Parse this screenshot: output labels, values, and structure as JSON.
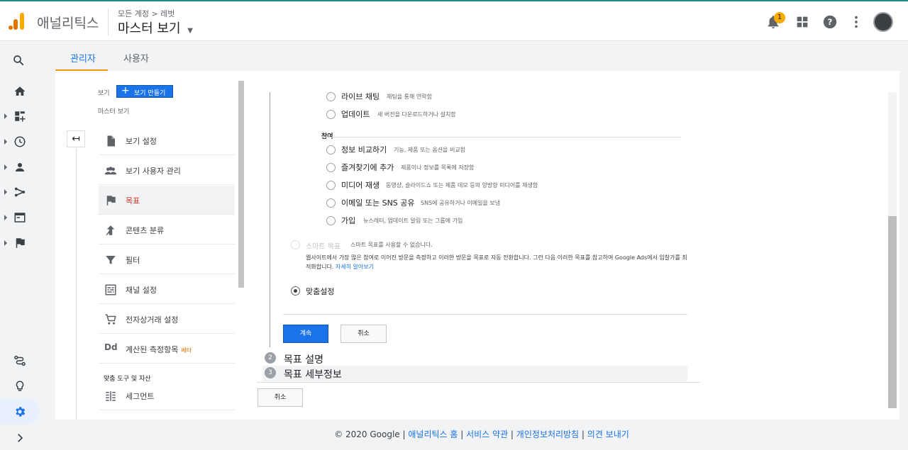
{
  "app": {
    "name": "애널리틱스",
    "breadcrumb": "모든 계정 > 레벗",
    "view_title": "마스터 보기",
    "notification_count": "1"
  },
  "tabs": [
    {
      "label": "관리자",
      "active": true
    },
    {
      "label": "사용자",
      "active": false
    }
  ],
  "left_nav": {
    "view_label": "보기",
    "create_view_button": "보기 만들기",
    "current_view": "마스터 보기",
    "items": [
      {
        "label": "보기 설정",
        "icon": "document-icon"
      },
      {
        "label": "보기 사용자 관리",
        "icon": "people-icon"
      },
      {
        "label": "목표",
        "icon": "flag-icon",
        "active": true
      },
      {
        "label": "콘텐츠 분류",
        "icon": "content-grouping-icon"
      },
      {
        "label": "필터",
        "icon": "filter-icon"
      },
      {
        "label": "채널 설정",
        "icon": "channel-settings-icon"
      },
      {
        "label": "전자상거래 설정",
        "icon": "cart-icon"
      },
      {
        "label": "계산된 측정항목",
        "icon": "dd-icon",
        "beta": "베타"
      }
    ],
    "tools_section": "맞춤 도구 및 자산",
    "tools_items": [
      {
        "label": "세그먼트",
        "icon": "segments-icon"
      }
    ]
  },
  "goal_options": {
    "top_options": [
      {
        "label": "라이브 채팅",
        "desc": "채팅을 통해 연락함"
      },
      {
        "label": "업데이트",
        "desc": "새 버전을 다운로드하거나 설치함"
      }
    ],
    "engagement_header": "참여",
    "engagement_options": [
      {
        "label": "정보 비교하기",
        "desc": "기능, 제품 또는 옵션을 비교함"
      },
      {
        "label": "즐겨찾기에 추가",
        "desc": "제품이나 정보를 목록에 저장함"
      },
      {
        "label": "미디어 재생",
        "desc": "동영상, 슬라이드쇼 또는 제품 데모 등의 양방향 미디어를 재생함"
      },
      {
        "label": "이메일 또는 SNS 공유",
        "desc": "SNS에 공유하거나 이메일을 보냄"
      },
      {
        "label": "가입",
        "desc": "뉴스레터, 업데이트 알림 또는 그룹에 가입"
      }
    ],
    "smart_goal_label": "스마트 목표",
    "smart_goal_desc": "스마트 목표를 사용할 수 없습니다.",
    "smart_goal_paragraph": "웹사이트에서 가장 많은 참여로 이어진 방문을 측정하고 이러한 방문을 목표로 자동 전환합니다. 그런 다음 이러한 목표를 참고하여 Google Ads에서 입찰가를 최적화합니다. ",
    "learn_more": "자세히 알아보기",
    "custom_label": "맞춤설정"
  },
  "buttons": {
    "continue": "계속",
    "cancel_inner": "취소",
    "cancel_outer": "취소"
  },
  "steps": [
    {
      "number": "2",
      "label": "목표 설명"
    },
    {
      "number": "3",
      "label": "목표 세부정보"
    }
  ],
  "footer": {
    "copyright": "© 2020 Google",
    "sep": " | ",
    "links": [
      "애널리틱스 홈",
      "서비스 약관",
      "개인정보처리방침",
      "의견 보내기"
    ]
  }
}
